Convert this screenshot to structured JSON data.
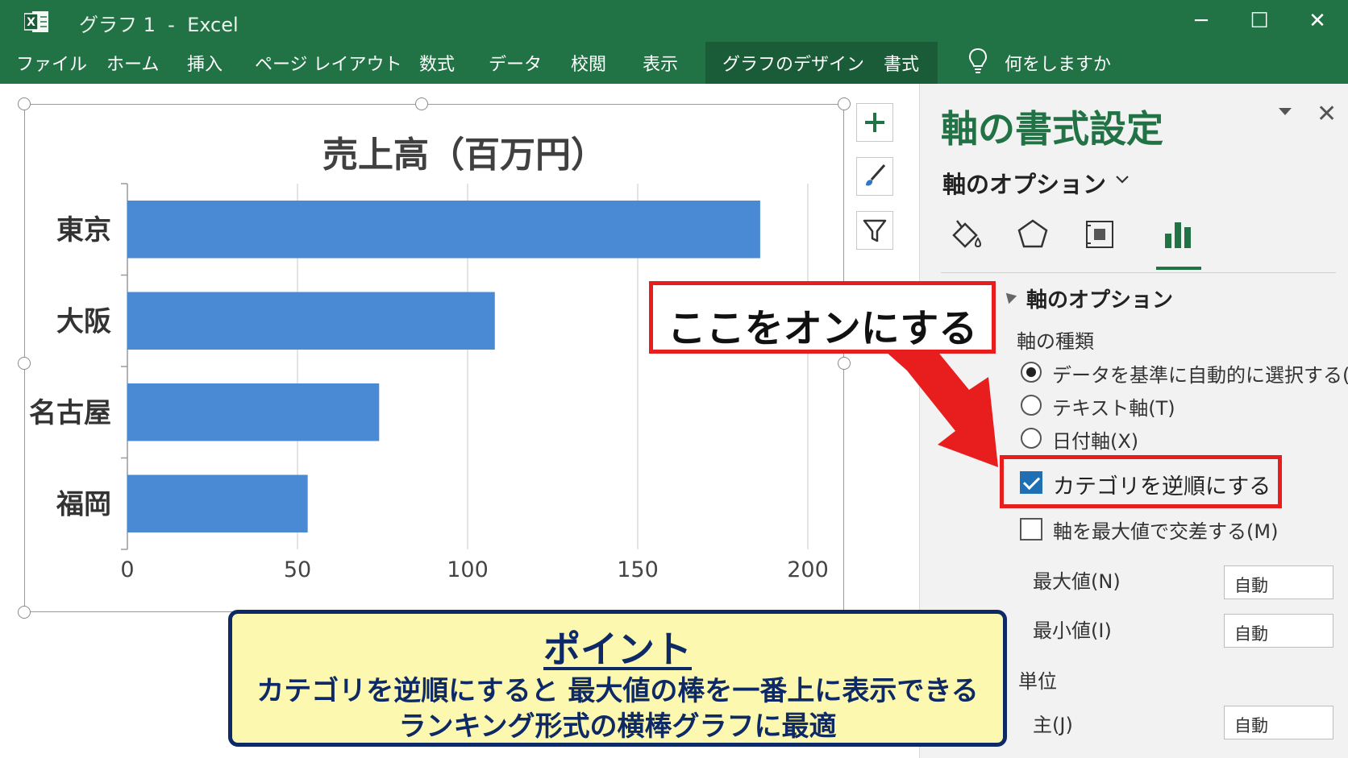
{
  "window": {
    "title": "グラフ 1  -  Excel",
    "minimize": "─",
    "maximize": "☐",
    "close": "✕"
  },
  "ribbon": {
    "tabs": [
      "ファイル",
      "ホーム",
      "挿入",
      "ページ レイアウト",
      "数式",
      "データ",
      "校閲",
      "表示",
      "グラフのデザイン",
      "書式"
    ],
    "tell_me": "何をしますか"
  },
  "chart_data": {
    "type": "bar",
    "orientation": "horizontal",
    "title": "売上高（百万円）",
    "categories": [
      "東京",
      "大阪",
      "名古屋",
      "福岡"
    ],
    "values": [
      186,
      108,
      74,
      53
    ],
    "xlim": [
      0,
      200
    ],
    "xticks": [
      "0",
      "50",
      "100",
      "150",
      "200"
    ],
    "grid": true,
    "legend": "none",
    "bar_color": "#4a8ad4"
  },
  "chart_tools": {
    "add_element": "+",
    "style": "brush-icon",
    "filter": "filter-icon"
  },
  "callout": {
    "text": "ここをオンにする"
  },
  "pane": {
    "title": "軸の書式設定",
    "close": "✕",
    "subtitle": "軸のオプション",
    "section": "軸のオプション",
    "axis_type_label": "軸の種類",
    "radios": [
      {
        "label": "データを基準に自動的に選択する(Y)",
        "checked": true
      },
      {
        "label": "テキスト軸(T)",
        "checked": false
      },
      {
        "label": "日付軸(X)",
        "checked": false
      }
    ],
    "checkboxes": [
      {
        "label": "カテゴリを逆順にする",
        "checked": true
      },
      {
        "label": "軸を最大値で交差する(M)",
        "checked": false
      }
    ],
    "max_label": "最大値(N)",
    "max_value": "自動",
    "min_label": "最小値(I)",
    "min_value": "自動",
    "unit_label": "単位",
    "major_label": "主(J)",
    "major_value": "自動"
  },
  "point": {
    "title": "ポイント",
    "line1": "カテゴリを逆順にすると 最大値の棒を一番上に表示できる",
    "line2": "ランキング形式の横棒グラフに最適"
  },
  "colors": {
    "excel_green": "#217346",
    "highlight_red": "#e81d1d",
    "point_bg": "#fdf8b0",
    "point_navy": "#0e2a66"
  }
}
